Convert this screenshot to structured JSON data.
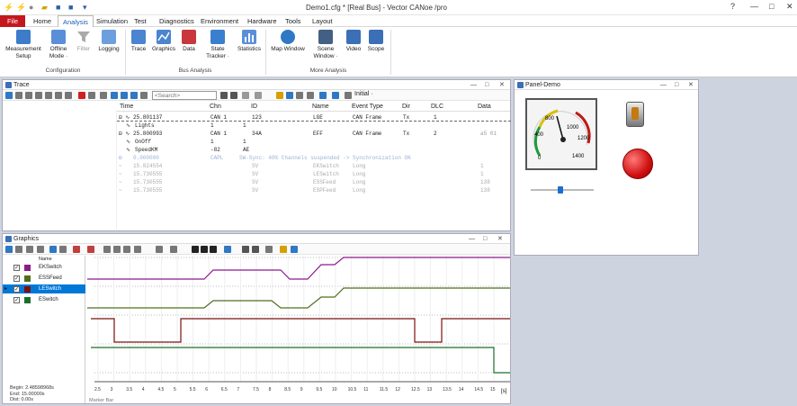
{
  "app": {
    "title": "Demo1.cfg * [Real Bus] - Vector CANoe /pro",
    "window_controls": [
      "?",
      "—",
      "□",
      "✕"
    ]
  },
  "menu": {
    "file": "File",
    "items": [
      "Home",
      "Analysis",
      "Simulation",
      "Test",
      "Diagnostics",
      "Environment",
      "Hardware",
      "Tools",
      "Layout"
    ],
    "active": "Analysis"
  },
  "ribbon": {
    "buttons": [
      {
        "label1": "Measurement",
        "label2": "Setup",
        "icon": "measurement-setup-icon"
      },
      {
        "label1": "Offline",
        "label2": "Mode ·",
        "icon": "offline-mode-icon"
      },
      {
        "label1": "Filter",
        "label2": "",
        "icon": "filter-icon"
      },
      {
        "label1": "Logging",
        "label2": "",
        "icon": "logging-icon"
      },
      {
        "label1": "Trace",
        "label2": "",
        "icon": "trace-icon"
      },
      {
        "label1": "Graphics",
        "label2": "",
        "icon": "graphics-icon"
      },
      {
        "label1": "Data",
        "label2": "",
        "icon": "data-icon"
      },
      {
        "label1": "State",
        "label2": "Tracker ·",
        "icon": "state-tracker-icon"
      },
      {
        "label1": "Statistics",
        "label2": "",
        "icon": "statistics-icon"
      },
      {
        "label1": "Map Window",
        "label2": "",
        "icon": "map-window-icon"
      },
      {
        "label1": "Scene",
        "label2": "Window ·",
        "icon": "scene-window-icon"
      },
      {
        "label1": "Video",
        "label2": "",
        "icon": "video-icon"
      },
      {
        "label1": "Scope",
        "label2": "",
        "icon": "scope-icon"
      }
    ],
    "groups": [
      "Configuration",
      "Bus Analysis",
      "More Analysis"
    ]
  },
  "trace": {
    "title": "Trace",
    "search_placeholder": "<Search>",
    "initial_label": "Initial ·",
    "columns": [
      "Time",
      "Chn",
      "ID",
      "Name",
      "Event Type",
      "Dir",
      "DLC",
      "Data"
    ],
    "rows": [
      {
        "time": "25.801137",
        "chn": "CAN 1",
        "id": "123",
        "name": "LGE",
        "type": "CAN Frame",
        "dir": "Tx",
        "dlc": "1",
        "data": "",
        "style": "dark"
      },
      {
        "time": "Lights",
        "chn": "1",
        "id": "1",
        "name": "",
        "type": "",
        "dir": "",
        "dlc": "",
        "data": "",
        "style": "dark"
      },
      {
        "time": "25.800993",
        "chn": "CAN 1",
        "id": "34A",
        "name": "EFF",
        "type": "CAN Frame",
        "dir": "Tx",
        "dlc": "2",
        "data": "a5 01",
        "style": "dark"
      },
      {
        "time": "OnOff",
        "chn": "1",
        "id": "1",
        "name": "",
        "type": "",
        "dir": "",
        "dlc": "",
        "data": "",
        "style": "dark"
      },
      {
        "time": "SpeedKM",
        "chn": "-82",
        "id": "AE",
        "name": "",
        "type": "",
        "dir": "",
        "dlc": "",
        "data": "",
        "style": "dark"
      },
      {
        "time": "0.000000",
        "chn": "CAPL",
        "id": "SW-Sync: 40% Channels suspended -> Synchronization OK",
        "name": "",
        "type": "",
        "dir": "",
        "dlc": "",
        "data": "",
        "style": "note"
      },
      {
        "time": "15.824554",
        "chn": "SV",
        "id": "SV",
        "name": "EKSwitch",
        "type": "Long",
        "dir": "",
        "dlc": "",
        "data": "1",
        "style": "gray"
      },
      {
        "time": "15.730555",
        "chn": "SV",
        "id": "SV",
        "name": "LESwitch",
        "type": "Long",
        "dir": "",
        "dlc": "",
        "data": "1",
        "style": "gray"
      },
      {
        "time": "15.730555",
        "chn": "SV",
        "id": "SV",
        "name": "ESSFeed",
        "type": "Long",
        "dir": "",
        "dlc": "",
        "data": "138",
        "style": "gray"
      },
      {
        "time": "15.730555",
        "chn": "SV",
        "id": "SV",
        "name": "ESPFeed",
        "type": "Long",
        "dir": "",
        "dlc": "",
        "data": "138",
        "style": "gray"
      }
    ]
  },
  "panel": {
    "title": "Panel-Demo",
    "gauge_ticks": [
      "0",
      "400",
      "800",
      "1000",
      "1200",
      "1400"
    ],
    "slider_level": 0.47
  },
  "graphics": {
    "title": "Graphics",
    "legend_header": "Name",
    "signals": [
      {
        "name": "EKSwitch",
        "color": "#8c1a8c",
        "checked": true,
        "selected": false
      },
      {
        "name": "ESSFeed",
        "color": "#4f6f1f",
        "checked": true,
        "selected": false
      },
      {
        "name": "LESwitch",
        "color": "#7a1010",
        "checked": true,
        "selected": true
      },
      {
        "name": "ESwitch",
        "color": "#1b6f2a",
        "checked": true,
        "selected": false
      }
    ],
    "info": [
      "Begin: 2.48598968s",
      "End: 15.00000s",
      "Dist: 0.00s"
    ],
    "x_unit": "[s]",
    "x_ticks": [
      "2.5",
      "3",
      "3.5",
      "4",
      "4.5",
      "5",
      "5.5",
      "6",
      "6.5",
      "7",
      "7.5",
      "8",
      "8.5",
      "9",
      "9.5",
      "10",
      "10.5",
      "11",
      "11.5",
      "12",
      "12.5",
      "13",
      "13.5",
      "14",
      "14.5",
      "15"
    ],
    "marker_bar": "Marker Bar"
  },
  "colors": {
    "file_red": "#c5161d",
    "accent_blue": "#1b5fb1",
    "selected_row": "#0078d7"
  }
}
